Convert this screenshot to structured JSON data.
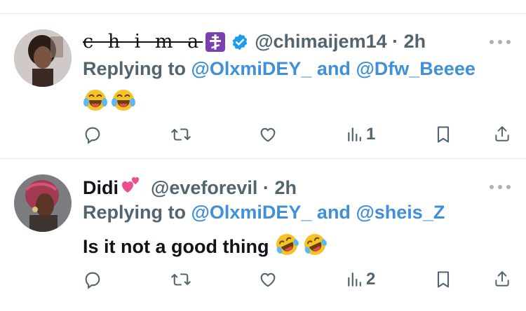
{
  "tweets": [
    {
      "display_name": "c h i m a",
      "handle": "@chimaijem14",
      "time": "2h",
      "replying_to": "Replying to",
      "mention_1": "@OlxmiDEY_",
      "conj": "and",
      "mention_2": "@Dfw_Beeee",
      "text": "",
      "views": "1",
      "badges": [
        "orthodox-cross-emoji",
        "verified-badge"
      ],
      "emoji": [
        "laughing-tears-emoji",
        "laughing-tears-emoji"
      ]
    },
    {
      "display_name": "Didi",
      "handle": "@eveforevil",
      "time": "2h",
      "replying_to": "Replying to",
      "mention_1": "@OlxmiDEY_",
      "conj": "and",
      "mention_2": "@sheis_Z",
      "text": "Is it not a good thing",
      "views": "2",
      "badges": [
        "two-hearts-emoji"
      ],
      "emoji": [
        "rofl-emoji",
        "rofl-emoji"
      ]
    }
  ],
  "colors": {
    "accent": "#3f8fd9",
    "muted": "#536471",
    "verified": "#1d9bf0",
    "cross_bg": "#7b3fb0"
  },
  "dot": "·"
}
